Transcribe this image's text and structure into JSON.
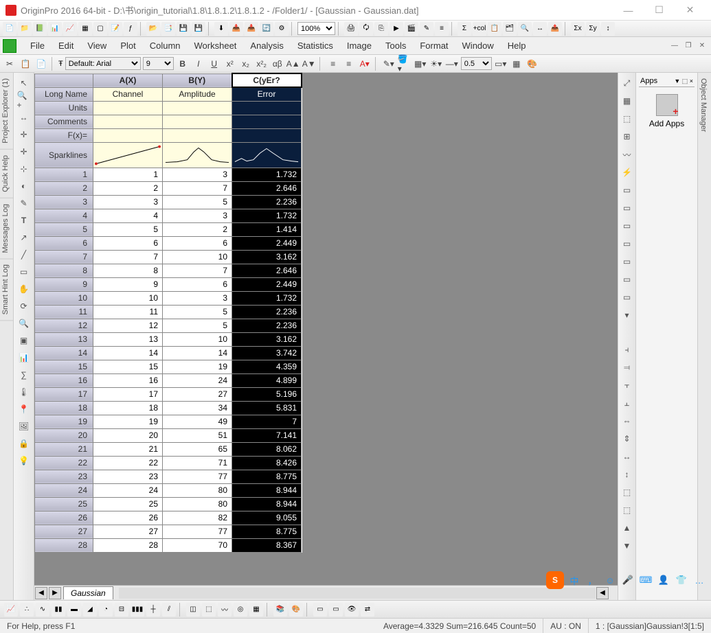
{
  "window": {
    "title": "OriginPro 2016 64-bit - D:\\书\\origin_tutorial\\1.8\\1.8.1.2\\1.8.1.2 - /Folder1/ - [Gaussian - Gaussian.dat]"
  },
  "menus": [
    "File",
    "Edit",
    "View",
    "Plot",
    "Column",
    "Worksheet",
    "Analysis",
    "Statistics",
    "Image",
    "Tools",
    "Format",
    "Window",
    "Help"
  ],
  "zoom": "100%",
  "font": {
    "family": "Default: Arial",
    "size": "9",
    "lineweight": "0.5"
  },
  "left_tabs": [
    "Project Explorer (1)",
    "Quick Help",
    "Messages Log",
    "Smart Hint Log"
  ],
  "right_tab": "Object Manager",
  "apps": {
    "header": "Apps",
    "item": "Add Apps"
  },
  "sheet": {
    "tab": "Gaussian",
    "headers": {
      "row_labels": [
        "Long Name",
        "Units",
        "Comments",
        "F(x)=",
        "Sparklines"
      ],
      "cols": [
        "A(X)",
        "B(Y)",
        "C(yEr?"
      ],
      "longnames": [
        "Channel",
        "Amplitude",
        "Error"
      ]
    },
    "rows": [
      {
        "n": 1,
        "a": 1,
        "b": 3,
        "c": "1.732"
      },
      {
        "n": 2,
        "a": 2,
        "b": 7,
        "c": "2.646"
      },
      {
        "n": 3,
        "a": 3,
        "b": 5,
        "c": "2.236"
      },
      {
        "n": 4,
        "a": 4,
        "b": 3,
        "c": "1.732"
      },
      {
        "n": 5,
        "a": 5,
        "b": 2,
        "c": "1.414"
      },
      {
        "n": 6,
        "a": 6,
        "b": 6,
        "c": "2.449"
      },
      {
        "n": 7,
        "a": 7,
        "b": 10,
        "c": "3.162"
      },
      {
        "n": 8,
        "a": 8,
        "b": 7,
        "c": "2.646"
      },
      {
        "n": 9,
        "a": 9,
        "b": 6,
        "c": "2.449"
      },
      {
        "n": 10,
        "a": 10,
        "b": 3,
        "c": "1.732"
      },
      {
        "n": 11,
        "a": 11,
        "b": 5,
        "c": "2.236"
      },
      {
        "n": 12,
        "a": 12,
        "b": 5,
        "c": "2.236"
      },
      {
        "n": 13,
        "a": 13,
        "b": 10,
        "c": "3.162"
      },
      {
        "n": 14,
        "a": 14,
        "b": 14,
        "c": "3.742"
      },
      {
        "n": 15,
        "a": 15,
        "b": 19,
        "c": "4.359"
      },
      {
        "n": 16,
        "a": 16,
        "b": 24,
        "c": "4.899"
      },
      {
        "n": 17,
        "a": 17,
        "b": 27,
        "c": "5.196"
      },
      {
        "n": 18,
        "a": 18,
        "b": 34,
        "c": "5.831"
      },
      {
        "n": 19,
        "a": 19,
        "b": 49,
        "c": "7"
      },
      {
        "n": 20,
        "a": 20,
        "b": 51,
        "c": "7.141"
      },
      {
        "n": 21,
        "a": 21,
        "b": 65,
        "c": "8.062"
      },
      {
        "n": 22,
        "a": 22,
        "b": 71,
        "c": "8.426"
      },
      {
        "n": 23,
        "a": 23,
        "b": 77,
        "c": "8.775"
      },
      {
        "n": 24,
        "a": 24,
        "b": 80,
        "c": "8.944"
      },
      {
        "n": 25,
        "a": 25,
        "b": 80,
        "c": "8.944"
      },
      {
        "n": 26,
        "a": 26,
        "b": 82,
        "c": "9.055"
      },
      {
        "n": 27,
        "a": 27,
        "b": 77,
        "c": "8.775"
      },
      {
        "n": 28,
        "a": 28,
        "b": 70,
        "c": "8.367"
      }
    ]
  },
  "status": {
    "help": "For Help, press F1",
    "stats": "Average=4.3329  Sum=216.645  Count=50",
    "au": "AU : ON",
    "win": "1 : [Gaussian]Gaussian!3[1:5]"
  },
  "ime": {
    "letters": [
      "中",
      "，",
      "☺",
      "🎤",
      "⌨",
      "👤",
      "👕",
      "…"
    ]
  }
}
